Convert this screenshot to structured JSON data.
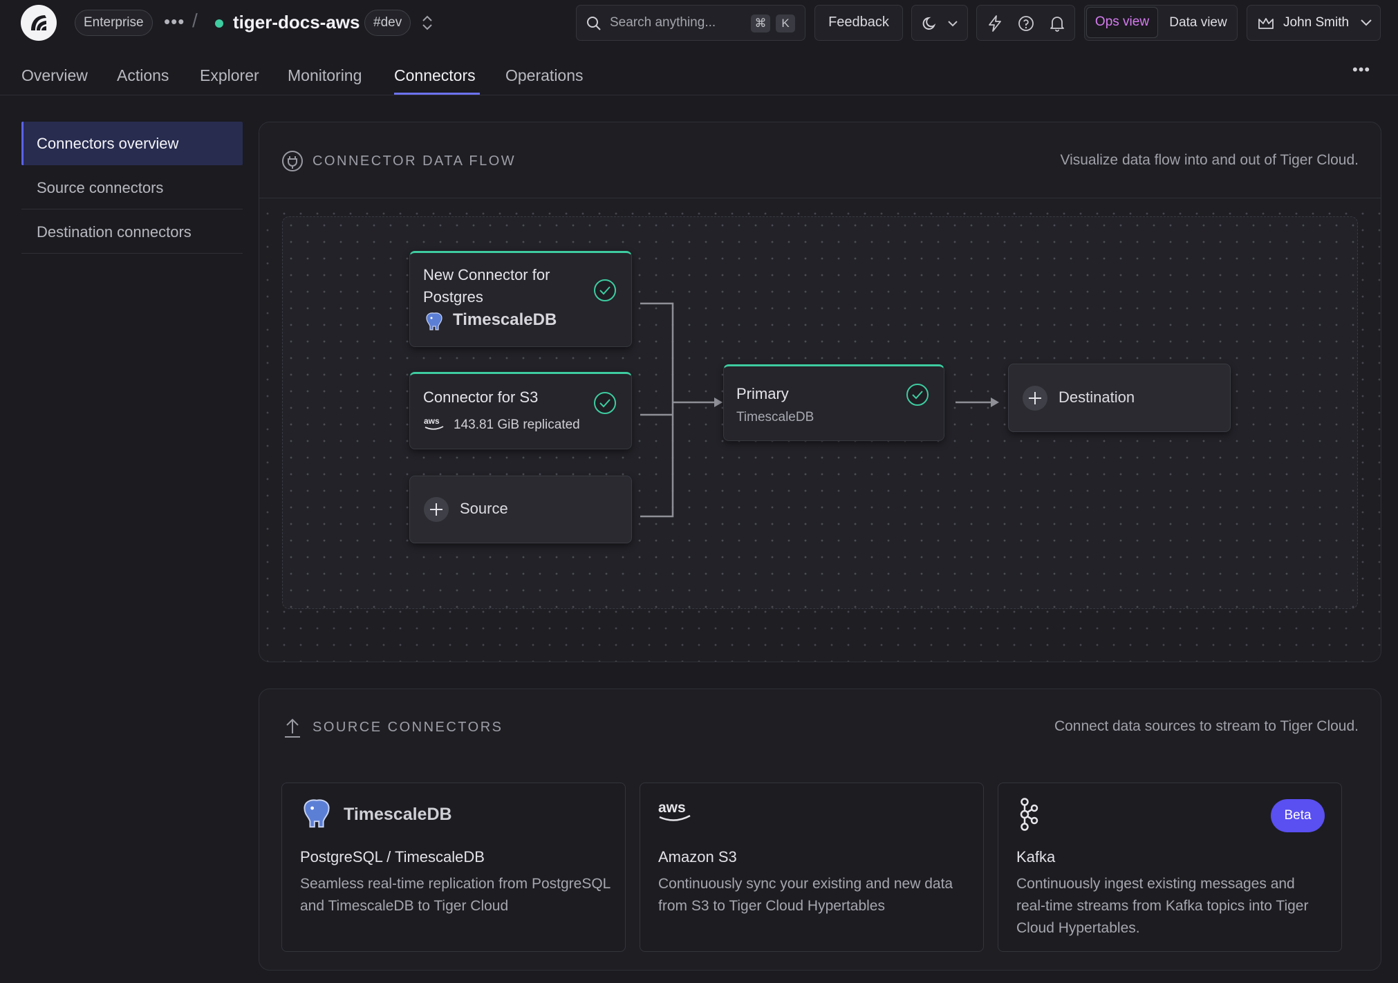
{
  "header": {
    "org_badge": "Enterprise",
    "service_name": "tiger-docs-aws",
    "env_badge": "#dev",
    "search_placeholder": "Search anything...",
    "shortcut_mod": "⌘",
    "shortcut_key": "K",
    "feedback_label": "Feedback",
    "ops_view_label": "Ops view",
    "data_view_label": "Data view",
    "user_name": "John Smith",
    "status_color": "#3ecca0"
  },
  "tabs": [
    "Overview",
    "Actions",
    "Explorer",
    "Monitoring",
    "Connectors",
    "Operations"
  ],
  "active_tab": "Connectors",
  "sidebar": {
    "items": [
      "Connectors overview",
      "Source connectors",
      "Destination connectors"
    ],
    "active": "Connectors overview"
  },
  "flow": {
    "title": "CONNECTOR DATA FLOW",
    "subtitle": "Visualize data flow into and out of Tiger Cloud.",
    "sources": [
      {
        "title": "New Connector for Postgres",
        "sub": "TimescaleDB",
        "status": "check-circle-icon"
      },
      {
        "title": "Connector for S3",
        "sub": "143.81 GiB replicated",
        "status": "check-circle-icon"
      }
    ],
    "add_source_label": "Source",
    "primary": {
      "title": "Primary",
      "sub": "TimescaleDB"
    },
    "add_destination_label": "Destination"
  },
  "source_connectors": {
    "title": "SOURCE CONNECTORS",
    "subtitle": "Connect data sources to stream to Tiger Cloud.",
    "cards": [
      {
        "logo_text": "TimescaleDB",
        "title": "PostgreSQL / TimescaleDB",
        "desc": "Seamless real-time replication from PostgreSQL and TimescaleDB to Tiger Cloud"
      },
      {
        "logo_text": "aws",
        "title": "Amazon S3",
        "desc": "Continuously sync your existing and new data from S3 to Tiger Cloud Hypertables"
      },
      {
        "logo_text": "",
        "title": "Kafka",
        "desc": "Continuously ingest existing messages and real-time streams from Kafka topics into Tiger Cloud Hypertables.",
        "badge": "Beta"
      }
    ]
  },
  "colors": {
    "accent": "#6c72f0",
    "success": "#3ecca0",
    "ops_view": "#d77cf0",
    "beta": "#5a4ff0"
  }
}
